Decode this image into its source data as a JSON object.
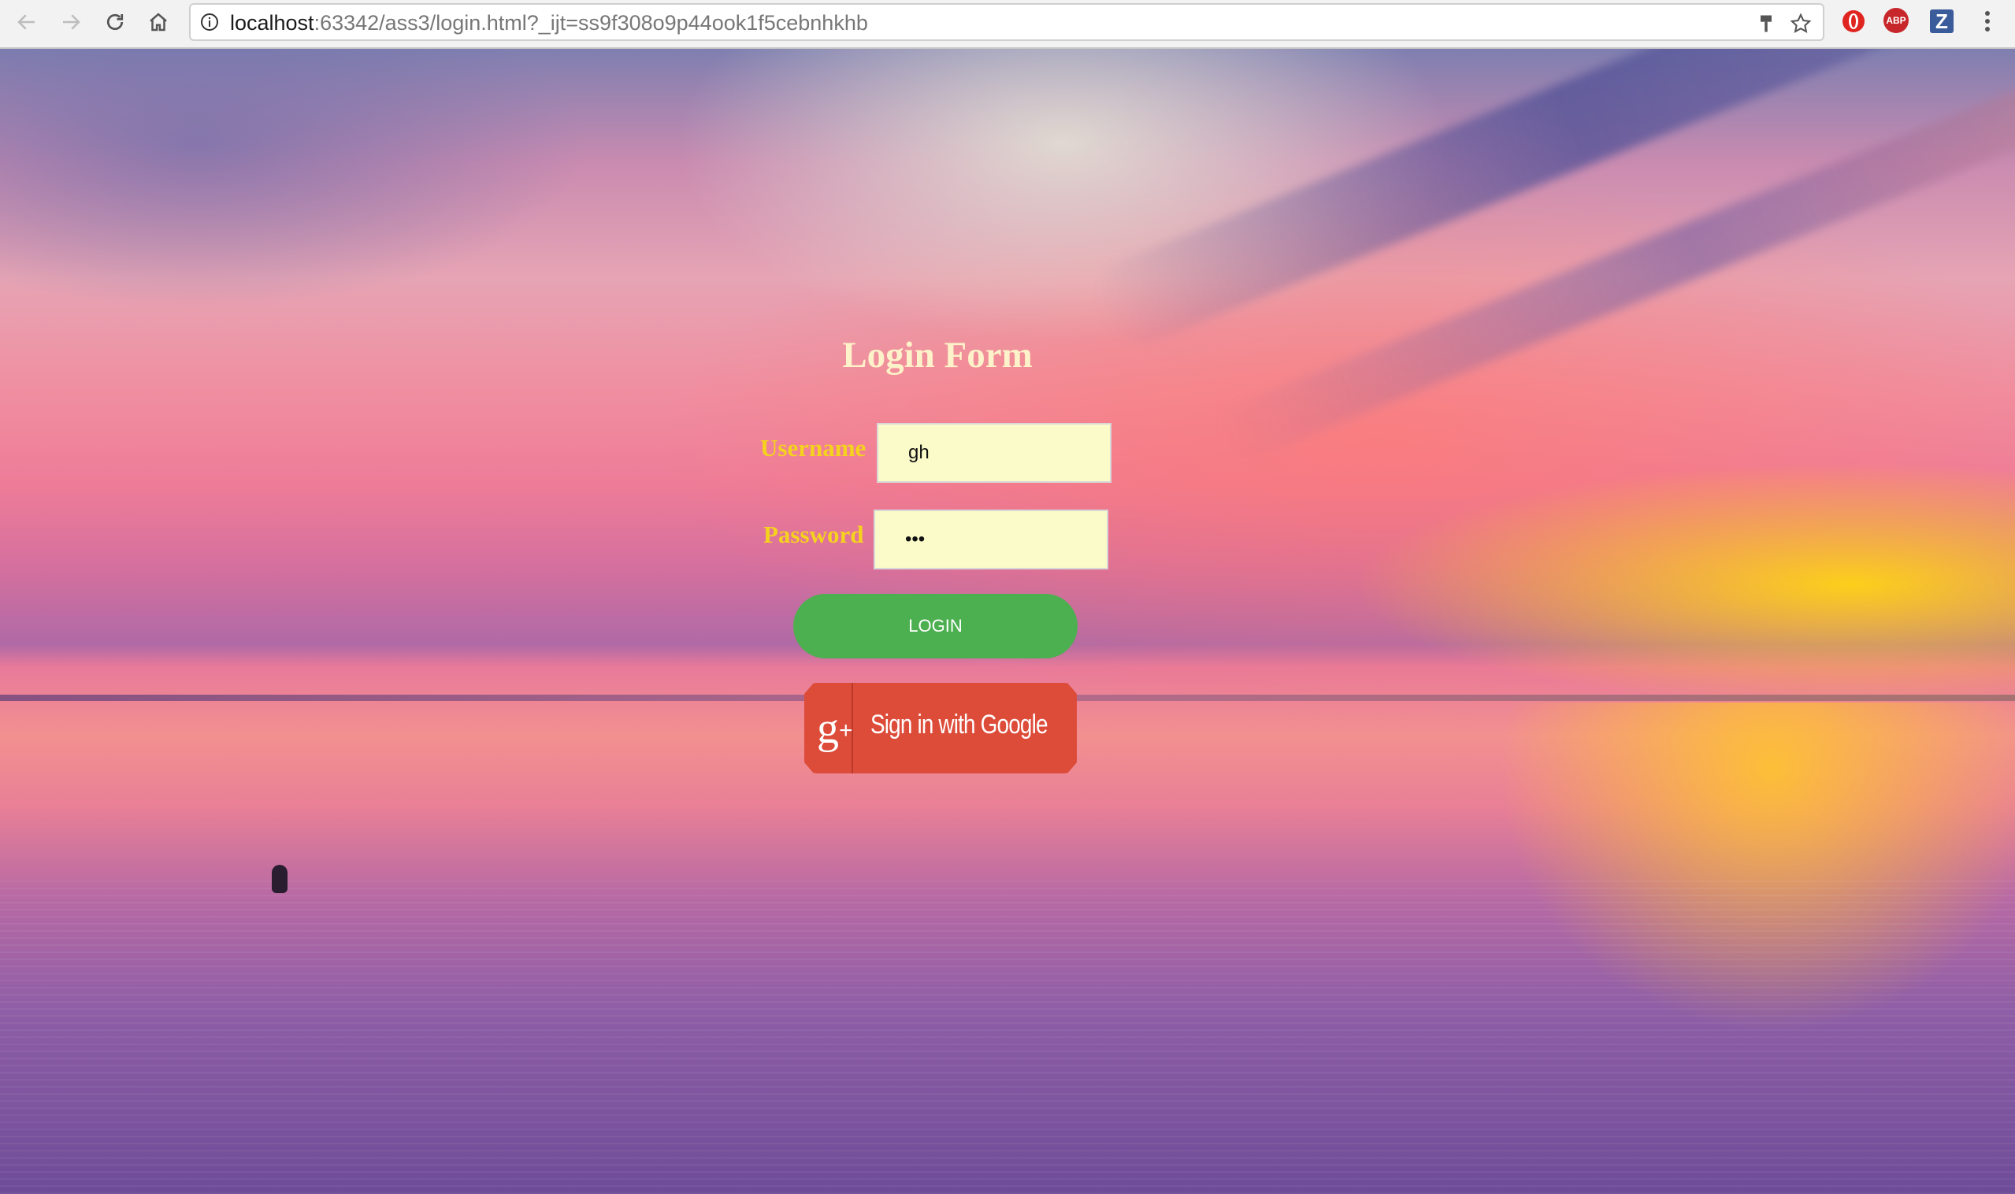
{
  "browser": {
    "url_host": "localhost",
    "url_rest": ":63342/ass3/login.html?_ijt=ss9f308o9p44ook1f5cebnhkhb",
    "extensions": {
      "abp_label": "ABP",
      "z_label": "Z"
    }
  },
  "login_form": {
    "title": "Login Form",
    "username_label": "Username",
    "username_value": "gh",
    "password_label": "Password",
    "password_value": "abc",
    "login_button": "Login",
    "google_button": "Sign in with Google",
    "google_logo": "g"
  },
  "colors": {
    "login_button": "#4caf50",
    "google_button": "#dd4b39",
    "label": "#f5d21e",
    "title": "#fdf2c9",
    "input_bg": "#fafbc8"
  }
}
